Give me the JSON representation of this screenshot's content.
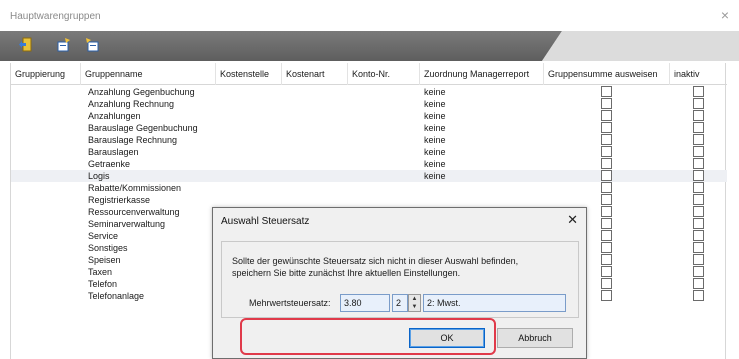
{
  "window": {
    "title": "Hauptwarengruppen",
    "close_glyph": "×"
  },
  "toolbar": {
    "icons": [
      "exit-icon",
      "new-record-icon",
      "new-sub-record-icon"
    ]
  },
  "columns": [
    "Gruppierung",
    "Gruppenname",
    "Kostenstelle",
    "Kostenart",
    "Konto-Nr.",
    "Zuordnung Managerreport",
    "Gruppensumme ausweisen",
    "inaktiv"
  ],
  "rows": [
    {
      "name": "Anzahlung Gegenbuchung",
      "report": "keine"
    },
    {
      "name": "Anzahlung Rechnung",
      "report": "keine"
    },
    {
      "name": "Anzahlungen",
      "report": "keine"
    },
    {
      "name": "Barauslage Gegenbuchung",
      "report": "keine"
    },
    {
      "name": "Barauslage Rechnung",
      "report": "keine"
    },
    {
      "name": "Barauslagen",
      "report": "keine"
    },
    {
      "name": "Getraenke",
      "report": "keine"
    },
    {
      "name": "Logis",
      "report": "keine",
      "selected": true
    },
    {
      "name": "Rabatte/Kommissionen",
      "report": ""
    },
    {
      "name": "Registrierkasse",
      "report": ""
    },
    {
      "name": "Ressourcenverwaltung",
      "report": ""
    },
    {
      "name": "Seminarverwaltung",
      "report": ""
    },
    {
      "name": "Service",
      "report": ""
    },
    {
      "name": "Sonstiges",
      "report": ""
    },
    {
      "name": "Speisen",
      "report": ""
    },
    {
      "name": "Taxen",
      "report": ""
    },
    {
      "name": "Telefon",
      "report": ""
    },
    {
      "name": "Telefonanlage",
      "report": ""
    }
  ],
  "dialog": {
    "title": "Auswahl Steuersatz",
    "close_glyph": "✕",
    "message_line1": "Sollte der gewünschte Steuersatz sich nicht in dieser Auswahl befinden,",
    "message_line2": "speichern Sie bitte zunächst Ihre aktuellen Einstellungen.",
    "field_label": "Mehrwertsteuersatz:",
    "rate_value": "3.80",
    "code_value": "2",
    "code_desc": "2: Mwst.",
    "ok_label": "OK",
    "cancel_label": "Abbruch"
  },
  "colors": {
    "highlight": "#e03a4a",
    "selected_row": "#eef0f4",
    "ok_border": "#0a64c8"
  }
}
